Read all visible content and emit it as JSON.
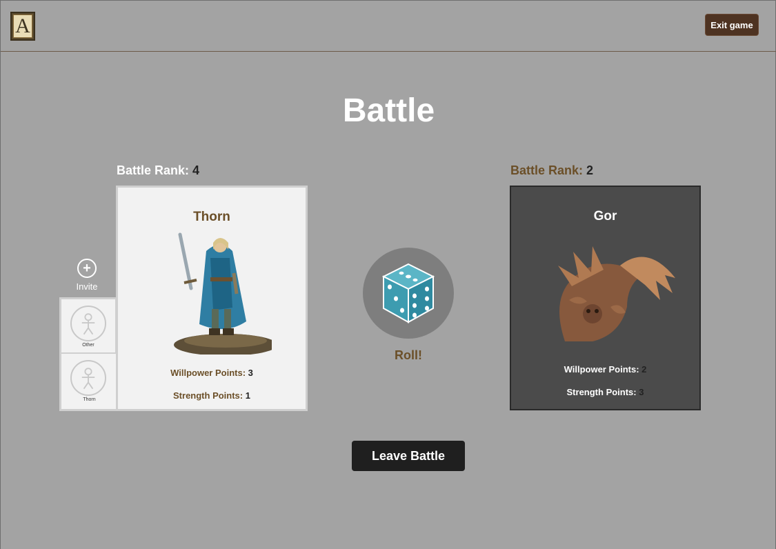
{
  "header": {
    "logo_letter": "A",
    "exit_label": "Exit game"
  },
  "page_title": "Battle",
  "hero_side": {
    "rank_label": "Battle Rank:",
    "rank_value": "4",
    "card": {
      "name": "Thorn",
      "willpower_label": "Willpower Points:",
      "willpower_value": "3",
      "strength_label": "Strength Points:",
      "strength_value": "1"
    },
    "invite_label": "Invite",
    "invite_icon": "plus-circle-icon",
    "players": [
      {
        "name": "Other",
        "icon": "person-icon"
      },
      {
        "name": "Thorn",
        "icon": "person-icon"
      }
    ]
  },
  "monster_side": {
    "rank_label": "Battle Rank:",
    "rank_value": "2",
    "card": {
      "name": "Gor",
      "willpower_label": "Willpower Points:",
      "willpower_value": "2",
      "strength_label": "Strength Points:",
      "strength_value": "3"
    }
  },
  "roll": {
    "label": "Roll!",
    "icon": "dice-icon"
  },
  "leave_label": "Leave Battle",
  "colors": {
    "background": "#a3a3a3",
    "accent_brown": "#6b4f28",
    "exit_button": "#4e3322",
    "monster_card": "#4b4b4b",
    "dice": "#4aa3b5"
  }
}
